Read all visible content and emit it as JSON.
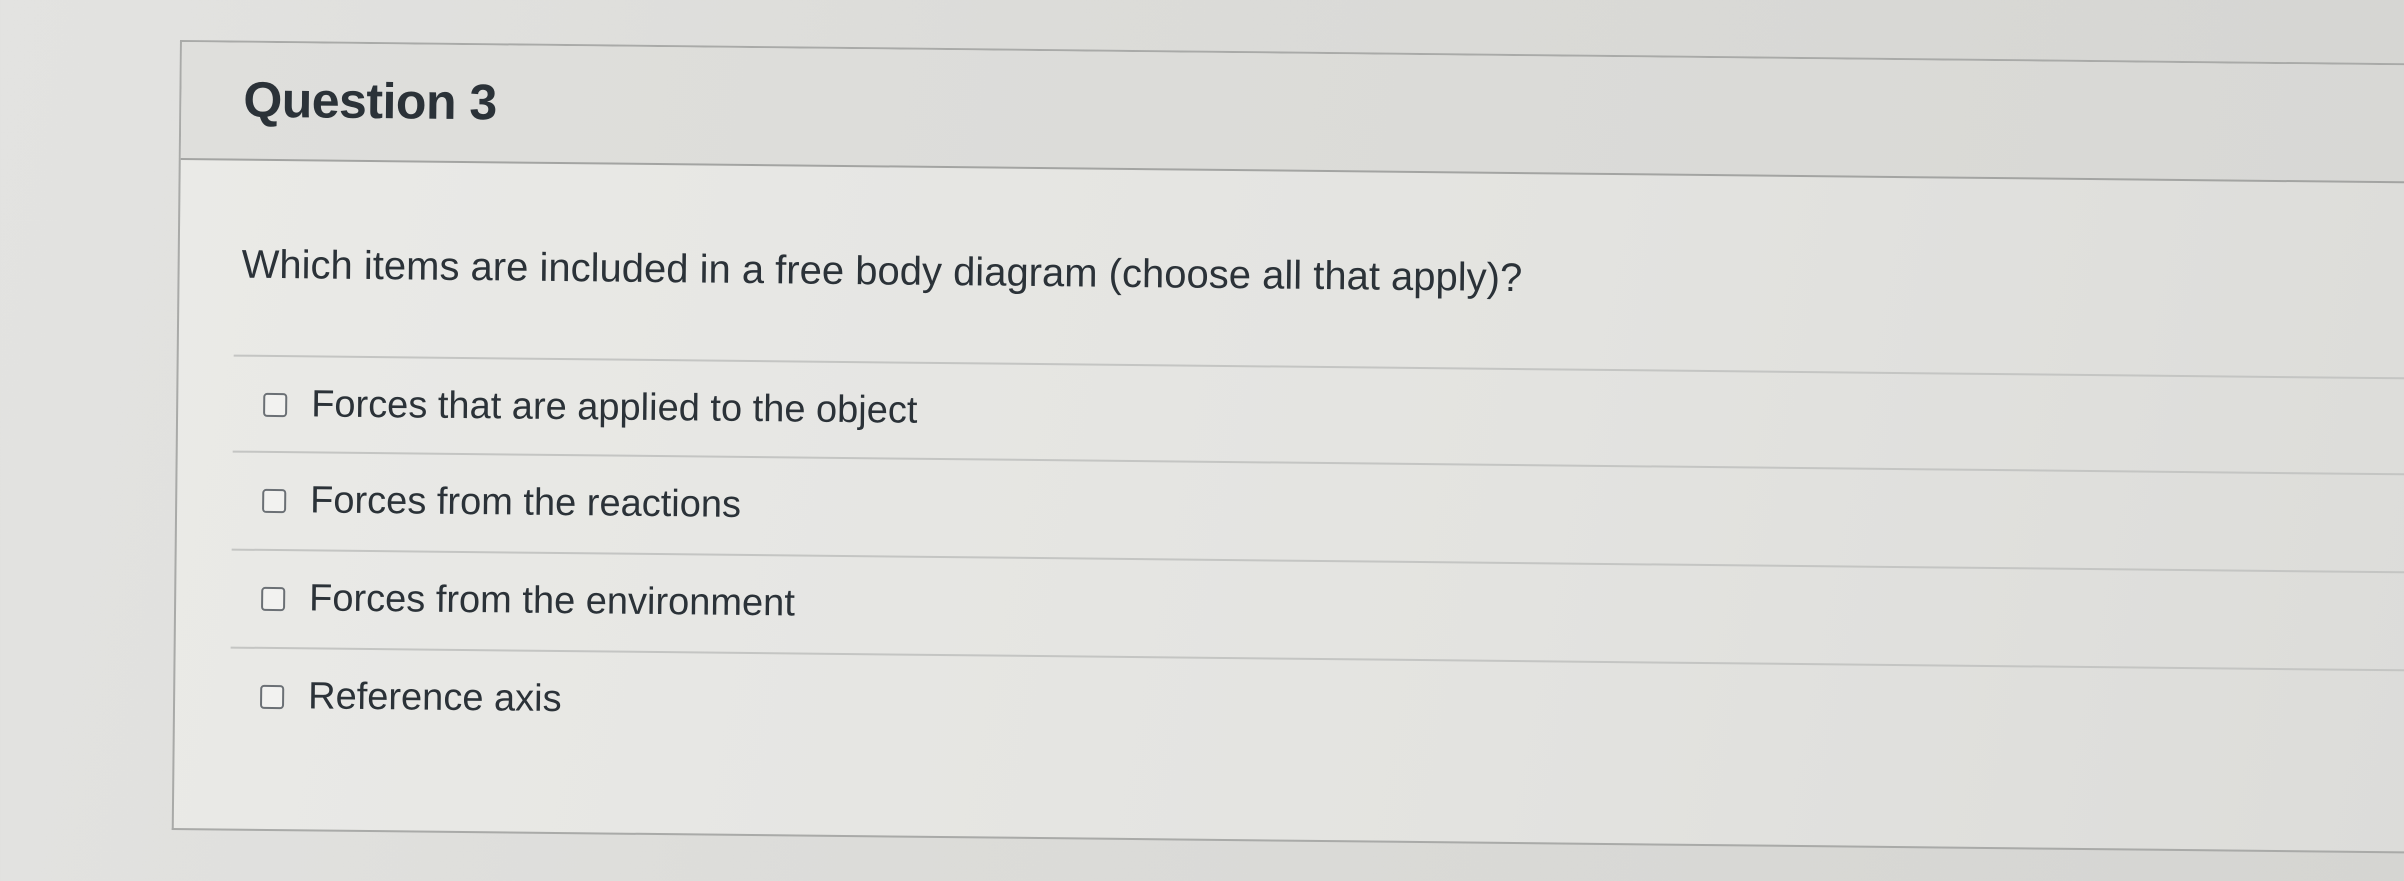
{
  "question": {
    "title": "Question 3",
    "text": "Which items are included in a free body diagram (choose all that apply)?"
  },
  "answers": [
    {
      "label": "Forces that are applied to the object",
      "checked": false
    },
    {
      "label": "Forces from the reactions",
      "checked": false
    },
    {
      "label": "Forces from the environment",
      "checked": false
    },
    {
      "label": "Reference axis",
      "checked": false
    }
  ]
}
